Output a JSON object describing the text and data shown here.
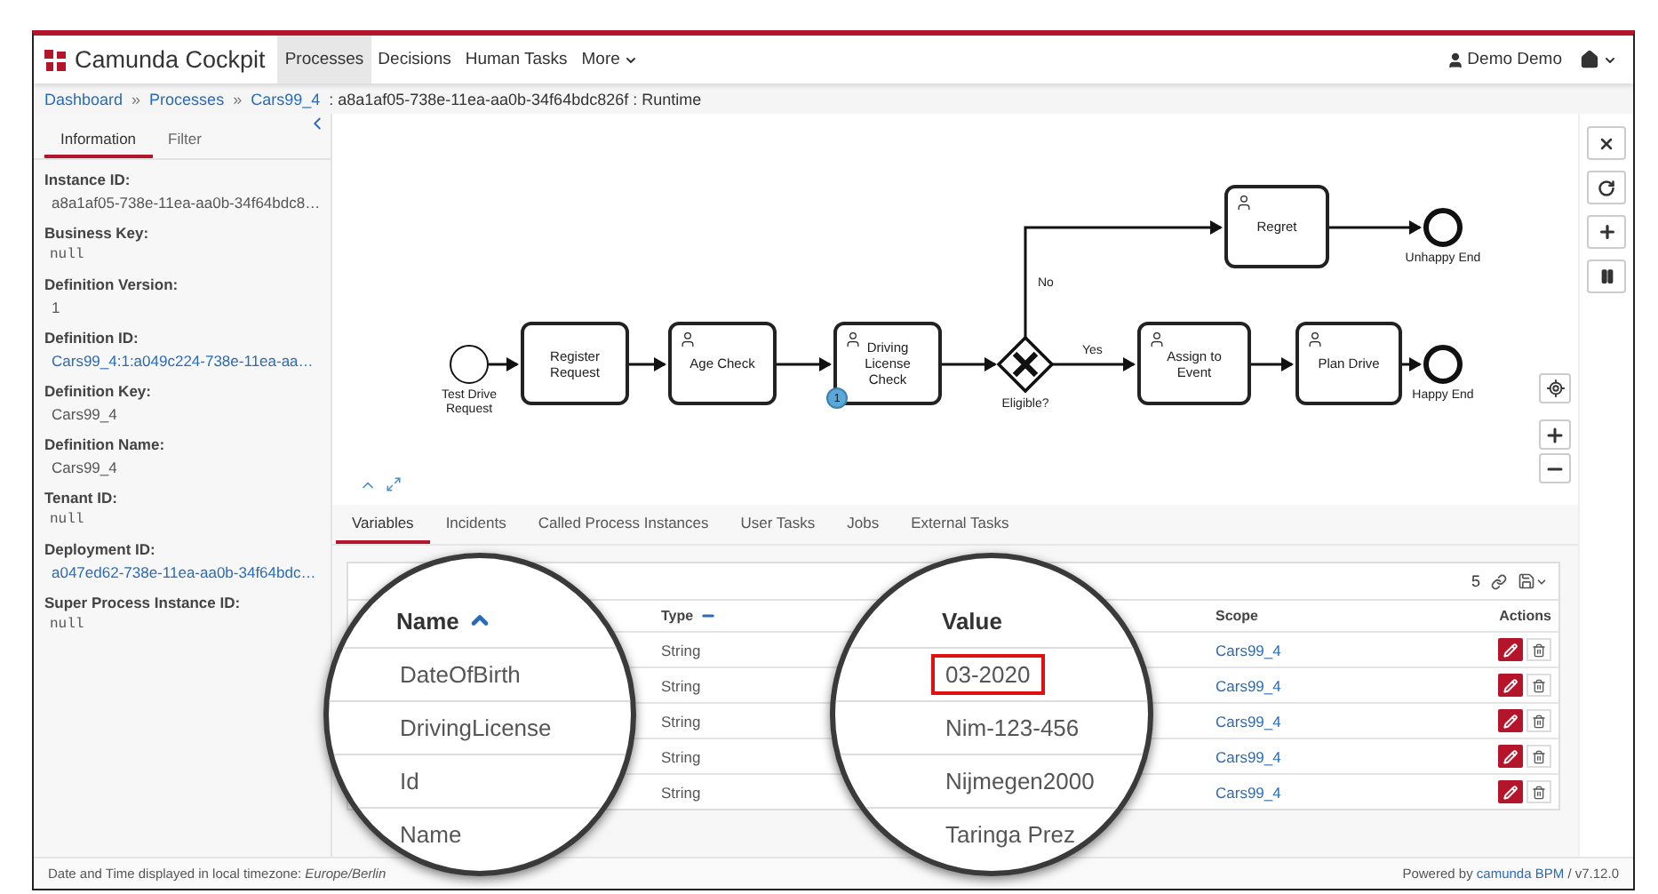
{
  "navbar": {
    "brand": "Camunda Cockpit",
    "items": [
      {
        "label": "Processes",
        "selected": true,
        "dropdown": false
      },
      {
        "label": "Decisions",
        "selected": false,
        "dropdown": false
      },
      {
        "label": "Human Tasks",
        "selected": false,
        "dropdown": false
      },
      {
        "label": "More",
        "selected": false,
        "dropdown": true
      }
    ],
    "user": "Demo Demo"
  },
  "breadcrumb": {
    "links": [
      "Dashboard",
      "Processes",
      "Cars99_4"
    ],
    "separator": "»",
    "current": ": a8a1af05-738e-11ea-aa0b-34f64bdc826f : Runtime"
  },
  "sidebar": {
    "tabs": [
      {
        "label": "Information",
        "selected": true
      },
      {
        "label": "Filter",
        "selected": false
      }
    ],
    "fields": [
      {
        "label": "Instance ID:",
        "value": "a8a1af05-738e-11ea-aa0b-34f64bdc8…",
        "kind": "text"
      },
      {
        "label": "Business Key:",
        "value": "null",
        "kind": "null"
      },
      {
        "label": "Definition Version:",
        "value": "1",
        "kind": "text"
      },
      {
        "label": "Definition ID:",
        "value": "Cars99_4:1:a049c224-738e-11ea-aa…",
        "kind": "link"
      },
      {
        "label": "Definition Key:",
        "value": "Cars99_4",
        "kind": "text"
      },
      {
        "label": "Definition Name:",
        "value": "Cars99_4",
        "kind": "text"
      },
      {
        "label": "Tenant ID:",
        "value": "null",
        "kind": "null"
      },
      {
        "label": "Deployment ID:",
        "value": "a047ed62-738e-11ea-aa0b-34f64bdc…",
        "kind": "link"
      },
      {
        "label": "Super Process Instance ID:",
        "value": "null",
        "kind": "null"
      }
    ]
  },
  "diagram": {
    "nodes": [
      {
        "kind": "start",
        "label": "Test Drive Request"
      },
      {
        "kind": "task",
        "label": "Register Request"
      },
      {
        "kind": "user_task",
        "label": "Age Check"
      },
      {
        "kind": "user_task",
        "label": "Driving License Check",
        "badge": "1"
      },
      {
        "kind": "gateway",
        "label": "Eligible?"
      },
      {
        "kind": "user_task",
        "label": "Regret"
      },
      {
        "kind": "end",
        "label": "Unhappy End"
      },
      {
        "kind": "user_task",
        "label": "Assign to Event"
      },
      {
        "kind": "user_task",
        "label": "Plan Drive"
      },
      {
        "kind": "end",
        "label": "Happy End"
      }
    ],
    "flow_labels": [
      "No",
      "Yes"
    ]
  },
  "tabs": [
    {
      "label": "Variables",
      "selected": true
    },
    {
      "label": "Incidents",
      "selected": false
    },
    {
      "label": "Called Process Instances",
      "selected": false
    },
    {
      "label": "User Tasks",
      "selected": false
    },
    {
      "label": "Jobs",
      "selected": false
    },
    {
      "label": "External Tasks",
      "selected": false
    }
  ],
  "variables": {
    "count": "5",
    "columns": [
      {
        "label": "Type",
        "sortable": true
      },
      {
        "label": "Scope",
        "sortable": false
      },
      {
        "label": "Actions",
        "sortable": false
      }
    ],
    "rows": [
      {
        "type": "String",
        "scope": "Cars99_4"
      },
      {
        "type": "String",
        "scope": "Cars99_4"
      },
      {
        "type": "String",
        "scope": "Cars99_4"
      },
      {
        "type": "String",
        "scope": "Cars99_4"
      },
      {
        "type": "String",
        "scope": "Cars99_4"
      }
    ]
  },
  "magnifiers": [
    {
      "heading": "Name",
      "sorted": true,
      "items": [
        {
          "text": "DateOfBirth",
          "highlighted": false
        },
        {
          "text": "DrivingLicense",
          "highlighted": false
        },
        {
          "text": "Id",
          "highlighted": false
        },
        {
          "text": "Name",
          "highlighted": false
        }
      ]
    },
    {
      "heading": "Value",
      "sorted": false,
      "items": [
        {
          "text": "03-2020",
          "highlighted": true
        },
        {
          "text": "Nim-123-456",
          "highlighted": false
        },
        {
          "text": "Nijmegen2000",
          "highlighted": false
        },
        {
          "text": "Taringa Prez",
          "highlighted": false
        }
      ]
    }
  ],
  "footer": {
    "timezone": "Date and Time displayed in local timezone: *Europe/Berlin*",
    "powered_by": "Powered by",
    "link": "camunda BPM",
    "version": "/ v7.12.0"
  }
}
